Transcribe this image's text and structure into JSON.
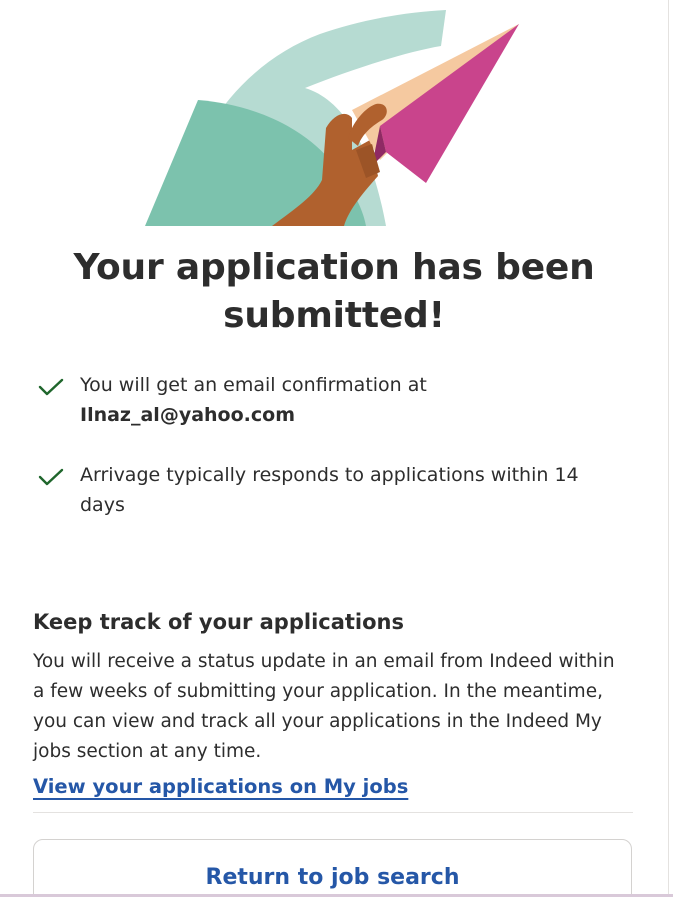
{
  "confirmation": {
    "title": "Your application has been submitted!",
    "checks": [
      {
        "text": "You will get an email confirmation at",
        "email": "Ilnaz_al@yahoo.com"
      },
      {
        "text": "Arrivage typically responds to applications within 14 days"
      }
    ]
  },
  "tracking": {
    "heading": "Keep track of your applications",
    "body": "You will receive a status update in an email from Indeed within a few weeks of submitting your application. In the meantime, you can view and track all your applications in the Indeed My jobs section at any time.",
    "link_label": "View your applications on My jobs"
  },
  "actions": {
    "return_label": "Return to job search"
  },
  "icons": {
    "check": "checkmark-icon",
    "illustration": "paper-plane-illustration"
  },
  "colors": {
    "link": "#2557a7",
    "check": "#1f662c",
    "text": "#2d2d2d",
    "illustration_teal": "#7cc2ad",
    "illustration_light_teal": "#b6dbd2",
    "plane_pink": "#c9448c",
    "plane_peach": "#f5c9a0",
    "hand_brown": "#b0612e"
  }
}
